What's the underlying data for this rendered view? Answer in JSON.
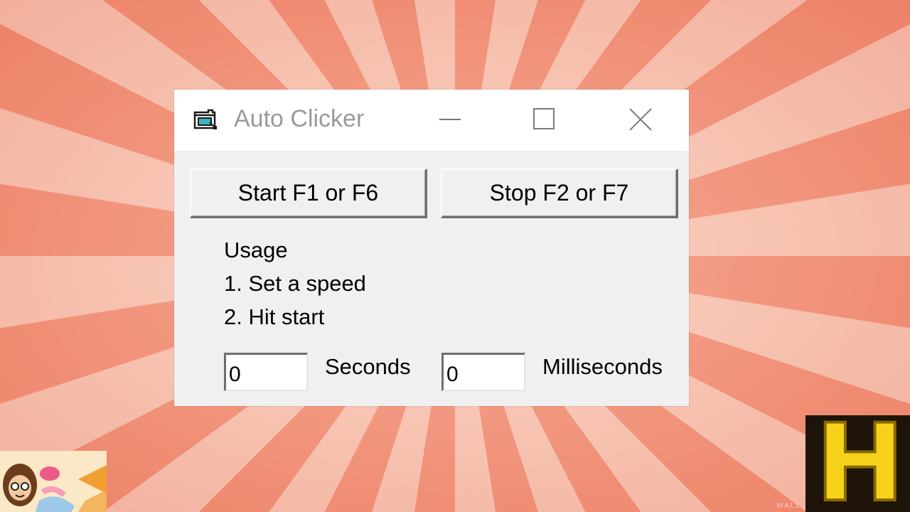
{
  "window": {
    "title": "Auto Clicker"
  },
  "buttons": {
    "start_label": "Start F1 or F6",
    "stop_label": "Stop F2 or F7"
  },
  "usage": {
    "heading": "Usage",
    "step1": "1. Set a speed",
    "step2": "2. Hit start"
  },
  "interval": {
    "seconds_value": "0",
    "seconds_label": "Seconds",
    "milliseconds_value": "0",
    "milliseconds_label": "Milliseconds"
  },
  "overlay": {
    "right_letter": "H",
    "watermark": "WALL"
  },
  "colors": {
    "background_ray_dark": "#f08c72",
    "background_ray_light": "#f7c4b3",
    "window_bg": "#f0f0f0",
    "title_text": "#9a9a9a"
  },
  "icons": [
    "app-icon",
    "minimize-icon",
    "maximize-icon",
    "close-icon"
  ]
}
